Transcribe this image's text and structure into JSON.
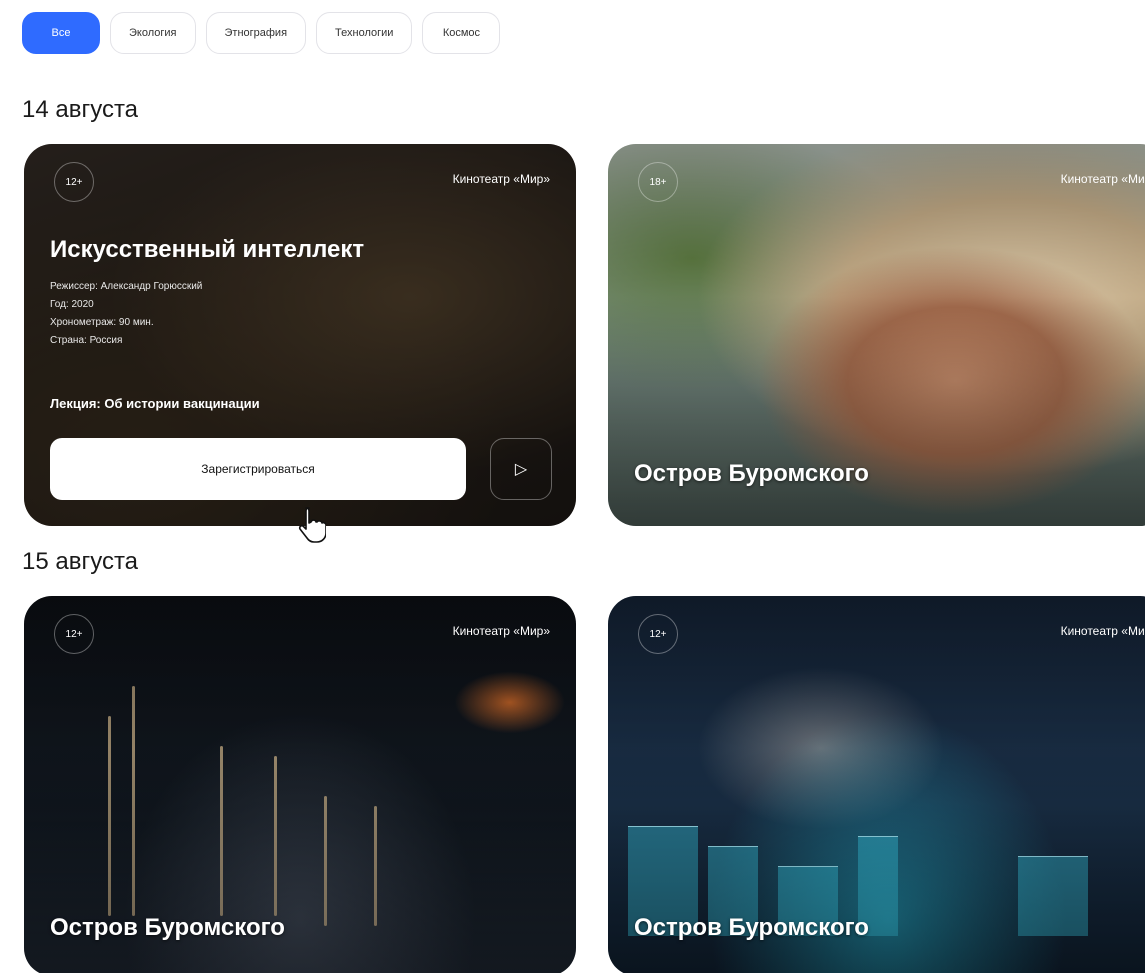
{
  "filters": [
    {
      "label": "Все",
      "active": true
    },
    {
      "label": "Экология",
      "active": false
    },
    {
      "label": "Этнография",
      "active": false
    },
    {
      "label": "Технологии",
      "active": false
    },
    {
      "label": "Космос",
      "active": false
    }
  ],
  "sections": [
    {
      "date": "14 августа"
    },
    {
      "date": "15 августа"
    }
  ],
  "cards": [
    {
      "age": "12+",
      "venue": "Кинотеатр «Мир»",
      "title": "Искусственный интеллект",
      "meta": [
        "Режиссер: Александр Горюсский",
        "Год: 2020",
        "Хронометраж: 90 мин.",
        "Страна: Россия"
      ],
      "lecture": "Лекция: Об истории вакцинации",
      "register_label": "Зарегистрироваться",
      "play_icon": "play-icon"
    },
    {
      "age": "18+",
      "venue": "Кинотеатр «Мир»",
      "title": "Остров Буромского"
    },
    {
      "age": "12+",
      "venue": "Кинотеатр «Мир»",
      "title": "Остров Буромского"
    },
    {
      "age": "12+",
      "venue": "Кинотеатр «Мир»",
      "title": "Остров Буромского"
    }
  ],
  "colors": {
    "accent": "#2f6bff"
  }
}
